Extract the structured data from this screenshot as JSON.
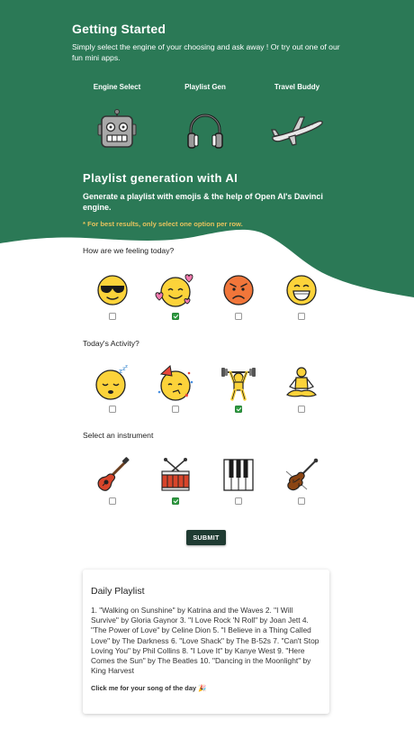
{
  "header": {
    "title": "Getting Started",
    "subtitle": "Simply select the engine of your choosing and ask away ! Or try out one of our fun mini apps.",
    "apps": [
      {
        "label": "Engine Select",
        "icon": "robot-icon"
      },
      {
        "label": "Playlist Gen",
        "icon": "headphones-icon"
      },
      {
        "label": "Travel Buddy",
        "icon": "airplane-icon"
      }
    ]
  },
  "playlist_section": {
    "title": "Playlist generation with AI",
    "subtitle": "Generate a playlist with emojis & the help of Open AI's Davinci engine.",
    "tip": "* For best results, only select one option per row."
  },
  "questions": [
    {
      "label": "How are we feeling today?",
      "options": [
        {
          "icon": "sunglasses-face-icon",
          "checked": false
        },
        {
          "icon": "smiling-face-with-hearts-icon",
          "checked": true
        },
        {
          "icon": "angry-face-icon",
          "checked": false
        },
        {
          "icon": "grinning-face-icon",
          "checked": false
        }
      ]
    },
    {
      "label": "Today's Activity?",
      "options": [
        {
          "icon": "sleeping-face-icon",
          "checked": false
        },
        {
          "icon": "partying-face-icon",
          "checked": false
        },
        {
          "icon": "weightlifter-icon",
          "checked": true
        },
        {
          "icon": "meditation-icon",
          "checked": false
        }
      ]
    },
    {
      "label": "Select an instrument",
      "options": [
        {
          "icon": "guitar-icon",
          "checked": false
        },
        {
          "icon": "drum-icon",
          "checked": true
        },
        {
          "icon": "piano-keys-icon",
          "checked": false
        },
        {
          "icon": "violin-icon",
          "checked": false
        }
      ]
    }
  ],
  "submit_label": "SUBMIT",
  "playlist_card": {
    "title": "Daily Playlist",
    "text": "1. \"Walking on Sunshine\" by Katrina and the Waves 2. \"I Will Survive\" by Gloria Gaynor 3. \"I Love Rock 'N Roll\" by Joan Jett 4. \"The Power of Love\" by Celine Dion 5. \"I Believe in a Thing Called Love\" by The Darkness 6. \"Love Shack\" by The B-52s 7. \"Can't Stop Loving You\" by Phil Collins 8. \"I Love It\" by Kanye West 9. \"Here Comes the Sun\" by The Beatles 10. \"Dancing in the Moonlight\" by King Harvest",
    "link": "Click me for your song of the day 🎉"
  },
  "colors": {
    "hero": "#2b7956",
    "button": "#1f3b32",
    "tip": "#e6c25d",
    "check": "#2e9a40"
  }
}
